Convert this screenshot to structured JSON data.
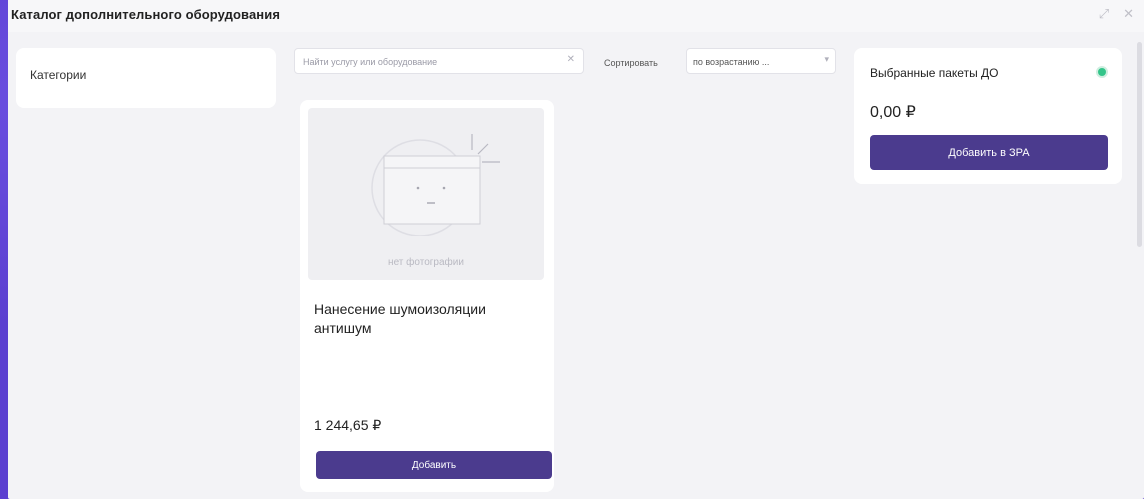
{
  "window": {
    "title": "Каталог дополнительного оборудования",
    "controls": [
      "expand-icon",
      "close-icon"
    ]
  },
  "categories": {
    "label": "Категории"
  },
  "search": {
    "placeholder": "Найти услугу или оборудование",
    "value": "",
    "clear_icon": "close-icon"
  },
  "sort": {
    "label": "Сортировать",
    "selected": "по возрастанию ...",
    "icon": "chevron-down-icon"
  },
  "products": [
    {
      "photo_caption": "нет фотографии",
      "title": "Нанесение шумоизоляции антишум",
      "price": "1 244,65 ₽",
      "button_label": "Добавить"
    }
  ],
  "summary": {
    "title": "Выбранные пакеты ДО",
    "total": "0,00 ₽",
    "status_color": "#34c58a",
    "button_label": "Добавить в ЗРА"
  },
  "colors": {
    "accent": "#4b3b8e",
    "backdrop": "#5b3fd0",
    "panel": "#f3f3f6"
  }
}
